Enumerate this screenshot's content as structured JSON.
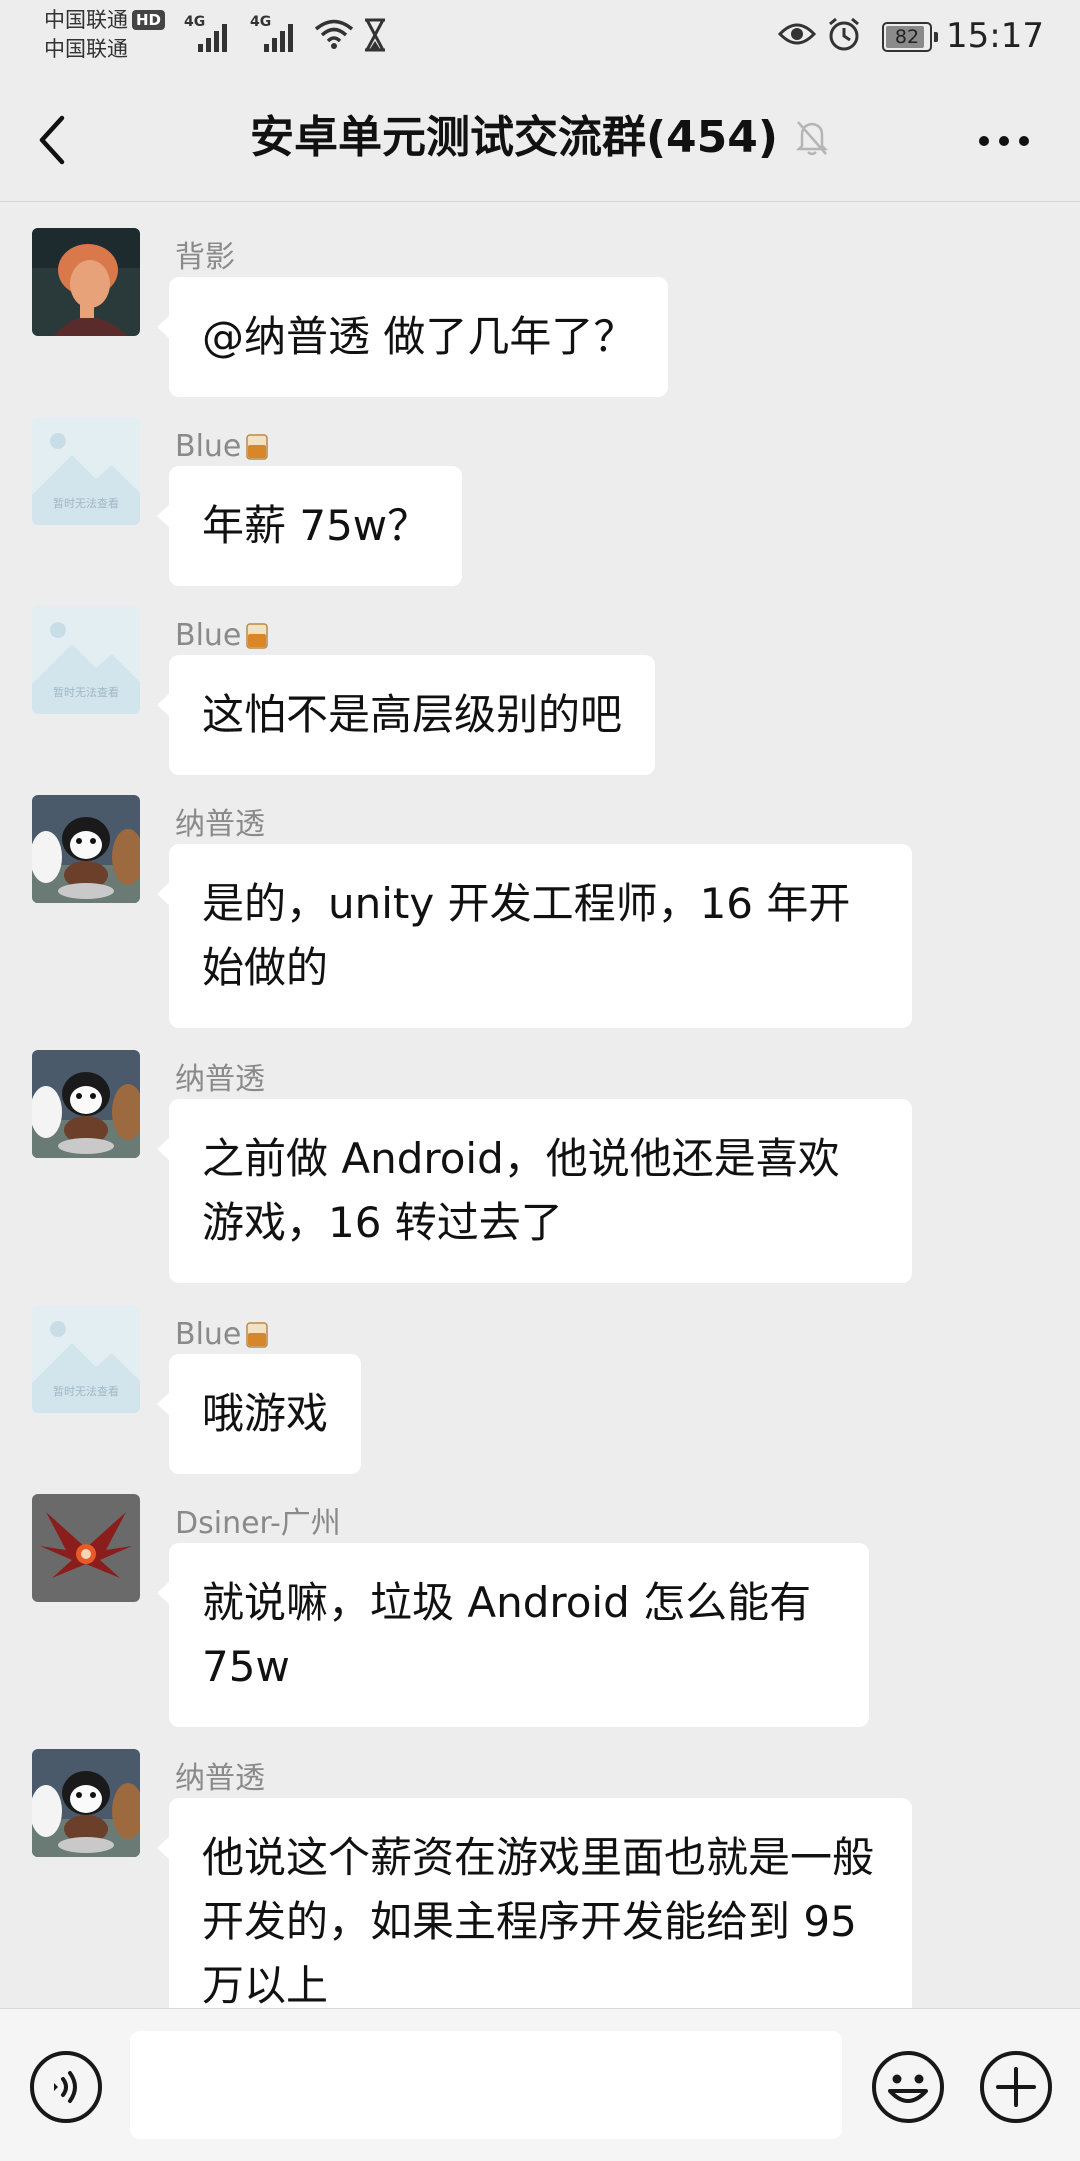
{
  "status_bar": {
    "carrier_1": "中国联通",
    "carrier_1_badge": "HD",
    "carrier_2": "中国联通",
    "network_1": "4G",
    "network_2": "4G",
    "battery_level": "82",
    "time": "15:17"
  },
  "header": {
    "title": "安卓单元测试交流群(454)"
  },
  "messages": [
    {
      "sender": "背影",
      "text": "@纳普透 做了几年了？"
    },
    {
      "sender": "Blue",
      "text": "年薪 75w？"
    },
    {
      "sender": "Blue",
      "text": "这怕不是高层级别的吧"
    },
    {
      "sender": "纳普透",
      "text": "是的，unity 开发工程师，16 年开始做的"
    },
    {
      "sender": "纳普透",
      "text": "之前做 Android，他说他还是喜欢游戏，16 转过去了"
    },
    {
      "sender": "Blue",
      "text": "哦游戏"
    },
    {
      "sender": "Dsiner-广州",
      "text": "就说嘛，垃圾 Android 怎么能有 75w"
    },
    {
      "sender": "纳普透",
      "text": "他说这个薪资在游戏里面也就是一般开发的，如果主程序开发能给到 95 万以上"
    }
  ],
  "placeholder_avatar_text": "暂时无法查看",
  "input": {
    "value": "",
    "placeholder": ""
  },
  "icons": {
    "back": "back-arrow-icon",
    "mute": "bell-off-icon",
    "more": "more-dots-icon",
    "voice": "voice-icon",
    "emoji": "emoji-icon",
    "plus": "plus-icon"
  },
  "colors": {
    "background": "#ededed",
    "bubble": "#ffffff",
    "sender_name": "#8a8a8a"
  }
}
